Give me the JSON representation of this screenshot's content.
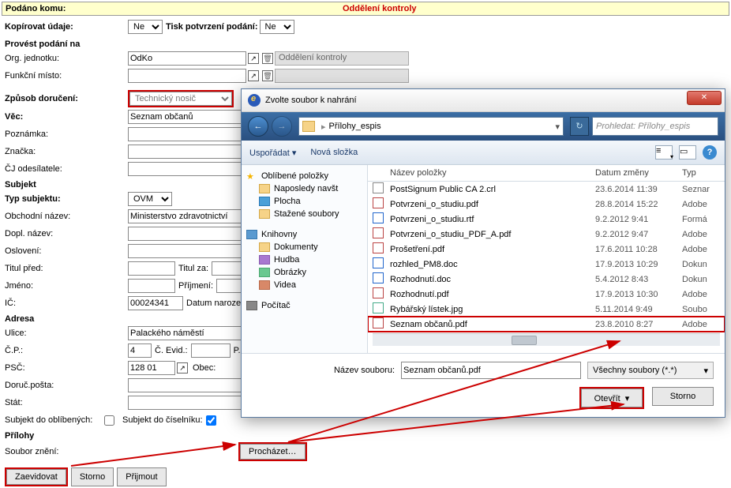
{
  "header": {
    "label": "Podáno komu:",
    "value": "Oddělení kontroly"
  },
  "form": {
    "kopirovat": {
      "label": "Kopírovat údaje:",
      "value": "Ne",
      "tisk_label": "Tisk potvrzení podání:",
      "tisk_value": "Ne"
    },
    "provest": {
      "label": "Provést podání na"
    },
    "org": {
      "label": "Org. jednotku:",
      "value": "OdKo",
      "display": "Oddělení kontroly"
    },
    "funkcni": {
      "label": "Funkční místo:"
    },
    "zpusob": {
      "label": "Způsob doručení:",
      "value": "Technický nosič"
    },
    "vec": {
      "label": "Věc:",
      "value": "Seznam občanů"
    },
    "poznamka": {
      "label": "Poznámka:"
    },
    "znacka": {
      "label": "Značka:"
    },
    "cj": {
      "label": "ČJ odesílatele:"
    },
    "subjekt_section": "Subjekt",
    "typ": {
      "label": "Typ subjektu:",
      "value": "OVM"
    },
    "obchodni": {
      "label": "Obchodní název:",
      "value": "Ministerstvo zdravotnictví"
    },
    "dopl": {
      "label": "Dopl. název:"
    },
    "osloveni": {
      "label": "Oslovení:"
    },
    "titul_pred": {
      "label": "Titul před:",
      "titul_za": "Titul za:"
    },
    "jmeno": {
      "label": "Jméno:",
      "prijmeni": "Příjmení:"
    },
    "ic": {
      "label": "IČ:",
      "value": "00024341",
      "datum": "Datum narození:"
    },
    "adresa_section": "Adresa",
    "ulice": {
      "label": "Ulice:",
      "value": "Palackého náměstí"
    },
    "cp": {
      "label": "Č.P.:",
      "value": "4",
      "evid": "Č. Evid.:",
      "po": "P.O"
    },
    "psc": {
      "label": "PSČ:",
      "value": "128 01",
      "obec": "Obec:"
    },
    "doruc": {
      "label": "Doruč.pošta:"
    },
    "stat": {
      "label": "Stát:"
    },
    "oblib": {
      "label": "Subjekt do oblíbených:",
      "ciselnik": "Subjekt do číselníku:"
    },
    "prilohy_section": "Přílohy",
    "soubor": {
      "label": "Soubor znění:",
      "btn": "Procházet…"
    }
  },
  "buttons": {
    "zaevidovat": "Zaevidovat",
    "storno": "Storno",
    "prijmout": "Přijmout"
  },
  "dialog": {
    "title": "Zvolte soubor k nahrání",
    "breadcrumb": "Přílohy_espis",
    "search_placeholder": "Prohledat: Přílohy_espis",
    "toolbar": {
      "usporadat": "Uspořádat",
      "nova": "Nová složka"
    },
    "sidebar": {
      "fav": "Oblíbené položky",
      "recent": "Naposledy navšt",
      "desktop": "Plocha",
      "downloads": "Stažené soubory",
      "libs": "Knihovny",
      "docs": "Dokumenty",
      "music": "Hudba",
      "pics": "Obrázky",
      "video": "Videa",
      "pc": "Počítač"
    },
    "columns": {
      "name": "Název položky",
      "date": "Datum změny",
      "type": "Typ"
    },
    "files": [
      {
        "ico": "crl",
        "name": "PostSignum Public CA 2.crl",
        "date": "23.6.2014 11:39",
        "type": "Seznar"
      },
      {
        "ico": "pdf",
        "name": "Potvrzeni_o_studiu.pdf",
        "date": "28.8.2014 15:22",
        "type": "Adobe"
      },
      {
        "ico": "doc",
        "name": "Potvrzeni_o_studiu.rtf",
        "date": "9.2.2012 9:41",
        "type": "Formá"
      },
      {
        "ico": "pdf",
        "name": "Potvrzeni_o_studiu_PDF_A.pdf",
        "date": "9.2.2012 9:47",
        "type": "Adobe"
      },
      {
        "ico": "pdf",
        "name": "Prošetření.pdf",
        "date": "17.6.2011 10:28",
        "type": "Adobe"
      },
      {
        "ico": "doc",
        "name": "rozhled_PM8.doc",
        "date": "17.9.2013 10:29",
        "type": "Dokun"
      },
      {
        "ico": "doc",
        "name": "Rozhodnutí.doc",
        "date": "5.4.2012 8:43",
        "type": "Dokun"
      },
      {
        "ico": "pdf",
        "name": "Rozhodnutí.pdf",
        "date": "17.9.2013 10:30",
        "type": "Adobe"
      },
      {
        "ico": "jpg",
        "name": "Rybářský lístek.jpg",
        "date": "5.11.2014 9:49",
        "type": "Soubo"
      },
      {
        "ico": "pdf",
        "name": "Seznam občanů.pdf",
        "date": "23.8.2010 8:27",
        "type": "Adobe",
        "sel": true
      }
    ],
    "footer": {
      "filename_label": "Název souboru:",
      "filename": "Seznam občanů.pdf",
      "filter": "Všechny soubory (*.*)",
      "open": "Otevřít",
      "cancel": "Storno"
    }
  }
}
